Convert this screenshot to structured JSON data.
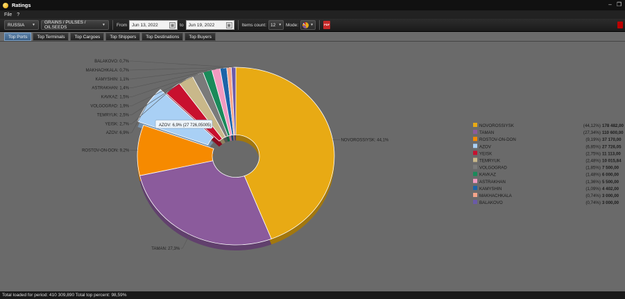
{
  "window": {
    "title": "Ratings"
  },
  "menu": {
    "file": "File",
    "help": "?"
  },
  "toolbar": {
    "country": "RUSSIA",
    "cargo_group": "GRAINS / PULSES / OILSEEDS",
    "from_label": "From",
    "from_date": "Jun 13, 2022",
    "to_label": "to",
    "to_date": "Jun 19, 2022",
    "items_count_label": "Items count:",
    "items_count": "12",
    "mode_label": "Mode:"
  },
  "tabs": [
    {
      "label": "Top Ports",
      "active": true
    },
    {
      "label": "Top Terminals"
    },
    {
      "label": "Top Cargoes"
    },
    {
      "label": "Top Shippers"
    },
    {
      "label": "Top Destinations"
    },
    {
      "label": "Top Buyers"
    }
  ],
  "tooltip": {
    "text": "AZOV: 6,9% (27 726,05005)"
  },
  "status": {
    "text": "Total loaded for period: 410 309,890 Total top percent: 98,59%"
  },
  "chart_data": {
    "type": "pie",
    "donut": true,
    "legend_position": "right",
    "slices": [
      {
        "name": "NOVOROSSIYSK",
        "pie_label": "NOVOROSSIYSK: 44,1%",
        "percent": 44.12,
        "percent_text": "(44,12%)",
        "value_text": "178 482,00",
        "color": "#e8aa14"
      },
      {
        "name": "TAMAN",
        "pie_label": "TAMAN: 27,3%",
        "percent": 27.34,
        "percent_text": "(27,34%)",
        "value_text": "110 600,00",
        "color": "#8b5b9c"
      },
      {
        "name": "ROSTOV-ON-DON",
        "pie_label": "ROSTOV-ON-DON: 9,2%",
        "percent": 9.19,
        "percent_text": "(9,19%)",
        "value_text": "37 170,00",
        "color": "#f68a00"
      },
      {
        "name": "AZOV",
        "pie_label": "AZOV: 6,9%",
        "percent": 6.85,
        "percent_text": "(6,85%)",
        "value_text": "27 726,05",
        "color": "#a9d0f5"
      },
      {
        "name": "YEISK",
        "pie_label": "YEISK: 2,7%",
        "percent": 2.75,
        "percent_text": "(2,75%)",
        "value_text": "11 113,00",
        "color": "#c8102e"
      },
      {
        "name": "TEMRYUK",
        "pie_label": "TEMRYUK: 2,5%",
        "percent": 2.48,
        "percent_text": "(2,48%)",
        "value_text": "10 015,84",
        "color": "#c9b88a"
      },
      {
        "name": "VOLGOGRAD",
        "pie_label": "VOLGOGRAD: 1,9%",
        "percent": 1.85,
        "percent_text": "(1,85%)",
        "value_text": "7 500,00",
        "color": "#7a7a7a"
      },
      {
        "name": "KAVKAZ",
        "pie_label": "KAVKAZ: 1,5%",
        "percent": 1.48,
        "percent_text": "(1,48%)",
        "value_text": "6 000,00",
        "color": "#1a8a5a"
      },
      {
        "name": "ASTRAKHAN",
        "pie_label": "ASTRAKHAN: 1,4%",
        "percent": 1.36,
        "percent_text": "(1,36%)",
        "value_text": "5 500,00",
        "color": "#f29ac0"
      },
      {
        "name": "KAMYSHIN",
        "pie_label": "KAMYSHIN: 1,1%",
        "percent": 1.09,
        "percent_text": "(1,09%)",
        "value_text": "4 402,00",
        "color": "#1d63a8"
      },
      {
        "name": "MAKHACHKALA",
        "pie_label": "MAKHACHKALA: 0,7%",
        "percent": 0.74,
        "percent_text": "(0,74%)",
        "value_text": "3 000,00",
        "color": "#f4a48a"
      },
      {
        "name": "BALAKOVO",
        "pie_label": "BALAKOVO: 0,7%",
        "percent": 0.74,
        "percent_text": "(0,74%)",
        "value_text": "3 000,00",
        "color": "#6a5aa8"
      }
    ]
  }
}
